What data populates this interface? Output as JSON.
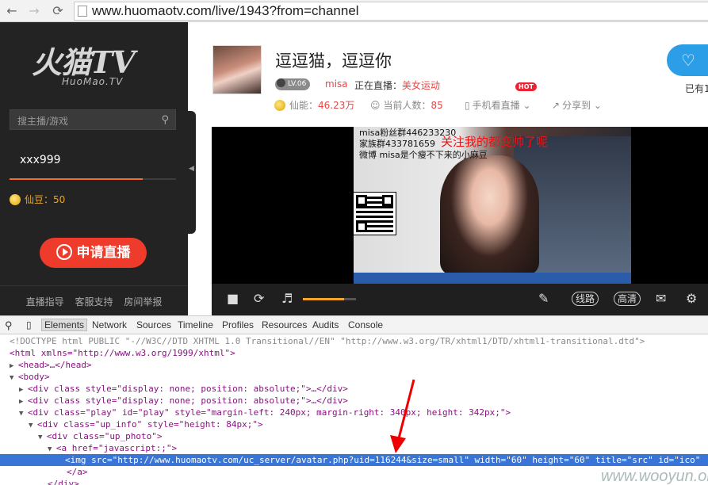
{
  "browser": {
    "url": "www.huomaotv.com/live/1943?from=channel"
  },
  "sidebar": {
    "logo_main": "火猫TV",
    "logo_sub": "HuoMao.TV",
    "search_placeholder": "搜主播/游戏",
    "username": "xxx999",
    "beans": "仙豆：50",
    "apply_button": "申请直播",
    "links": [
      "直播指导",
      "客服支持",
      "房间举报"
    ]
  },
  "room": {
    "title": "逗逗猫，逗逗你",
    "level": "LV.06",
    "anchor": "misa",
    "live_label": "正在直播：",
    "category": "美女运动",
    "xianneng_label": "仙能：",
    "xianneng_value": "46.23万",
    "viewers_label": "当前人数：",
    "viewers_value": "85",
    "mobile_watch": "手机看直播",
    "hot_badge": "HOT",
    "share": "分享到",
    "followers_partial": "已有1"
  },
  "video_overlay": {
    "lines": [
      "misa粉丝群446233230",
      "家族群433781659",
      "微博 misa是个瘦不下来的小麻豆"
    ],
    "red_text": "关注我的都变帅了呢"
  },
  "player_controls": {
    "volume": 0.78,
    "route_label": "线路",
    "quality_label": "高清"
  },
  "devtools": {
    "tabs": [
      "Elements",
      "Network",
      "Sources",
      "Timeline",
      "Profiles",
      "Resources",
      "Audits",
      "Console"
    ],
    "lines": [
      "<!DOCTYPE html PUBLIC \"-//W3C//DTD XHTML 1.0 Transitional//EN\" \"http://www.w3.org/TR/xhtml1/DTD/xhtml1-transitional.dtd\">",
      "<html xmlns=\"http://www.w3.org/1999/xhtml\">",
      "<head>…</head>",
      "<body>",
      "<div class style=\"display: none; position: absolute;\">…</div>",
      "<div class style=\"display: none; position: absolute;\">…</div>",
      "<div class=\"play\" id=\"play\" style=\"margin-left: 240px; margin-right: 340px; height: 342px;\">",
      "<div class=\"up_info\" style=\"height: 84px;\">",
      "<div class=\"up_photo\">",
      "<a href=\"javascript:;\">",
      "<img src=\"http://www.huomaotv.com/uc_server/avatar.php?uid=116244&size=small\" width=\"60\" height=\"60\" title=\"src\" id=\"ico\"",
      "</a>",
      "</div>"
    ]
  },
  "watermark": "www.wooyun.org"
}
